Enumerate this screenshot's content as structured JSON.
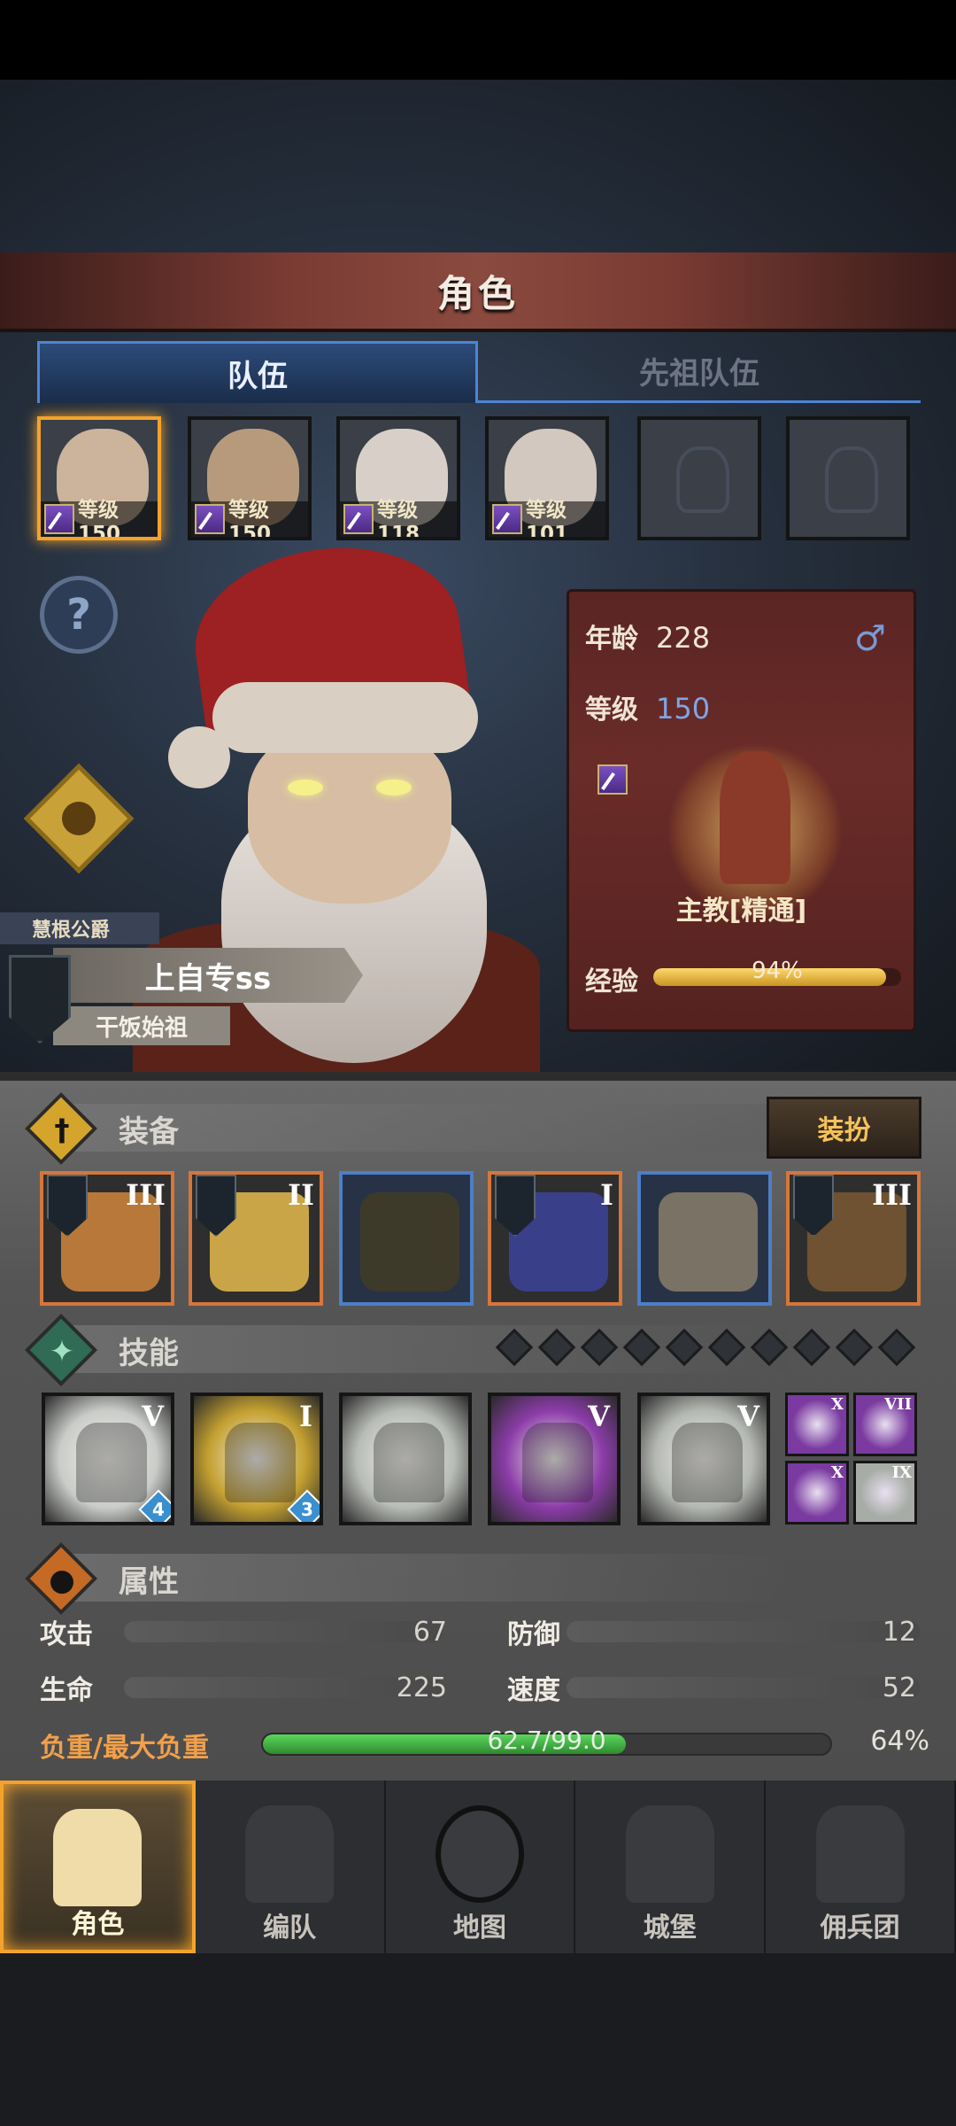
{
  "header": {
    "title": "角色"
  },
  "tabs": [
    {
      "label": "队伍",
      "active": true
    },
    {
      "label": "先祖队伍",
      "active": false
    }
  ],
  "team": [
    {
      "level_text": "等级150",
      "selected": true,
      "face_color": "#cbb39c"
    },
    {
      "level_text": "等级150",
      "selected": false,
      "face_color": "#b79a7c"
    },
    {
      "level_text": "等级118",
      "selected": false,
      "face_color": "#d8d0c8"
    },
    {
      "level_text": "等级101",
      "selected": false,
      "face_color": "#d2c8bf"
    },
    {
      "level_text": "",
      "selected": false,
      "empty": true
    },
    {
      "level_text": "",
      "selected": false,
      "empty": true
    }
  ],
  "hero": {
    "rank": "慧根公爵",
    "name": "上自专ss",
    "title": "干饭始祖"
  },
  "info": {
    "age_label": "年龄",
    "age": "228",
    "level_label": "等级",
    "level": "150",
    "gender_icon": "♂",
    "class_name": "主教[精通]",
    "exp_label": "经验",
    "exp_text": "94%",
    "exp_fraction": 0.94
  },
  "equipment": {
    "title": "装备",
    "dress_button": "装扮",
    "slots": [
      {
        "tier": "III",
        "border": "orange",
        "color": "#b8783a"
      },
      {
        "tier": "II",
        "border": "orange",
        "color": "#c9a548"
      },
      {
        "tier": "",
        "border": "blue",
        "color": "#3e3a2a"
      },
      {
        "tier": "I",
        "border": "orange",
        "color": "#3a3f8a"
      },
      {
        "tier": "",
        "border": "blue",
        "color": "#7a7264"
      },
      {
        "tier": "III",
        "border": "orange",
        "color": "#6e5232"
      }
    ]
  },
  "skills": {
    "title": "技能",
    "slots": [
      {
        "tier": "V",
        "count": "4",
        "color": "#c9ccc8"
      },
      {
        "tier": "I",
        "count": "3",
        "color": "#c4a030"
      },
      {
        "tier": "",
        "count": "",
        "color": "#b8bcb6"
      },
      {
        "tier": "V",
        "count": "",
        "color": "#8b3ca8"
      },
      {
        "tier": "V",
        "count": "",
        "color": "#b4b8b2"
      }
    ],
    "mini": [
      {
        "tier": "X",
        "color": "#7a3aa0"
      },
      {
        "tier": "VII",
        "color": "#7a3aa0"
      },
      {
        "tier": "X",
        "color": "#7a3aa0"
      },
      {
        "tier": "IX",
        "color": "#a8aca6"
      }
    ]
  },
  "attributes": {
    "title": "属性",
    "attack_label": "攻击",
    "attack": "67",
    "defense_label": "防御",
    "defense": "12",
    "hp_label": "生命",
    "hp": "225",
    "speed_label": "速度",
    "speed": "52",
    "load_label": "负重/最大负重",
    "load_text": "62.7/99.0",
    "load_pct": "64%",
    "load_fraction": 0.64
  },
  "nav": [
    {
      "label": "角色",
      "active": true,
      "icon": "knight-icon"
    },
    {
      "label": "编队",
      "active": false,
      "icon": "helmet-icon"
    },
    {
      "label": "地图",
      "active": false,
      "icon": "compass-icon"
    },
    {
      "label": "城堡",
      "active": false,
      "icon": "castle-icon"
    },
    {
      "label": "佣兵团",
      "active": false,
      "icon": "banner-icon"
    }
  ]
}
